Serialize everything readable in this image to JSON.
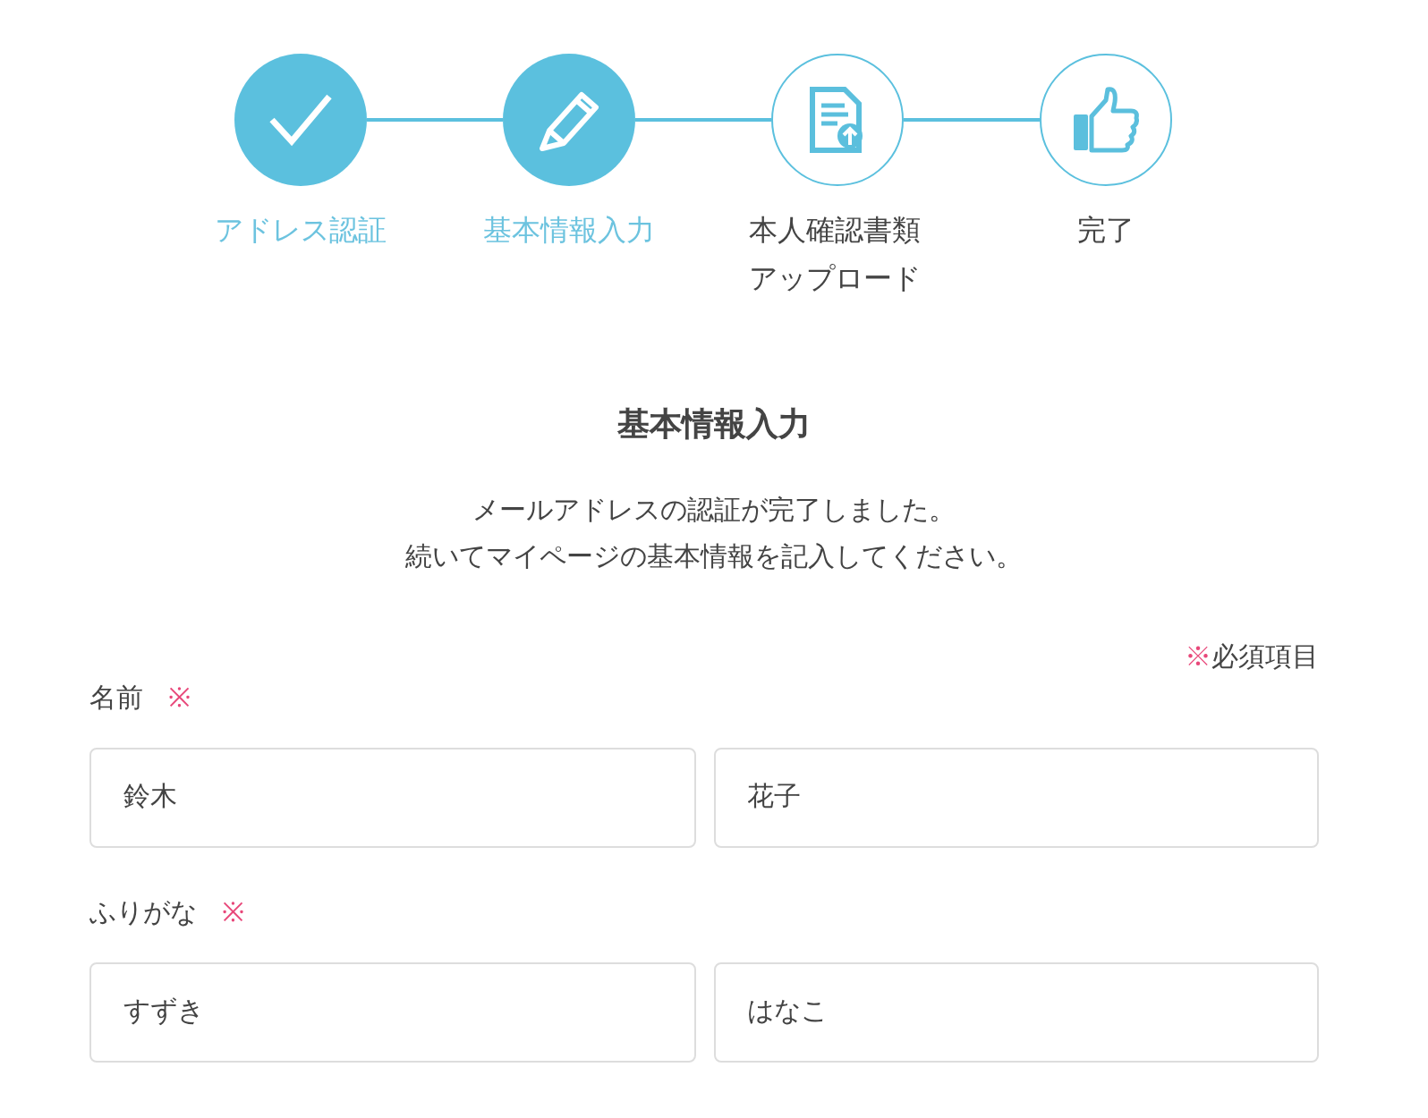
{
  "steps": [
    {
      "kind": "check",
      "label": "アドレス認証",
      "completed": true
    },
    {
      "kind": "pencil",
      "label": "基本情報入力",
      "completed": true
    },
    {
      "kind": "document-upload",
      "label": "本人確認書類アップロード",
      "completed": false
    },
    {
      "kind": "thumbs-up",
      "label": "完了",
      "completed": false
    }
  ],
  "heading": "基本情報入力",
  "description": [
    "メールアドレスの認証が完了しました。",
    "続いてマイページの基本情報を記入してください。"
  ],
  "required_note": {
    "mark": "※",
    "text": "必須項目"
  },
  "fields": [
    {
      "label": "名前",
      "required_mark": "※",
      "inputs": [
        {
          "value": "鈴木"
        },
        {
          "value": "花子"
        }
      ]
    },
    {
      "label": "ふりがな",
      "required_mark": "※",
      "inputs": [
        {
          "value": "すずき"
        },
        {
          "value": "はなこ"
        }
      ]
    }
  ]
}
